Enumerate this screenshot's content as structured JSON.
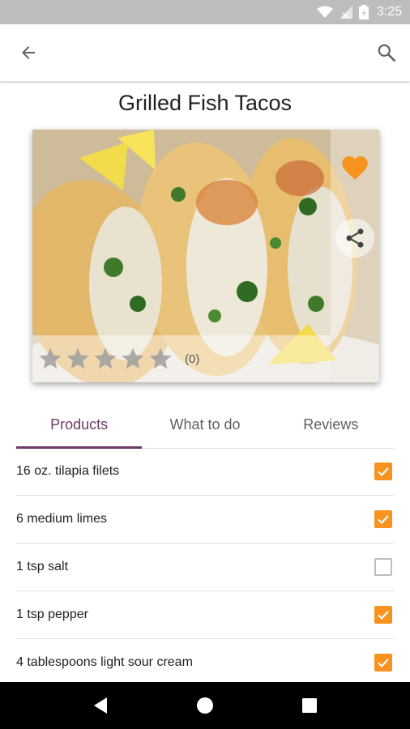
{
  "status_bar": {
    "time": "3:25"
  },
  "recipe": {
    "title": "Grilled Fish Tacos",
    "rating": {
      "stars": 0,
      "max_stars": 5,
      "count_label": "(0)"
    },
    "favorite": true
  },
  "tabs": [
    {
      "label": "Products",
      "active": true
    },
    {
      "label": "What to do",
      "active": false
    },
    {
      "label": "Reviews",
      "active": false
    }
  ],
  "products": [
    {
      "label": "16 oz. tilapia filets",
      "checked": true
    },
    {
      "label": "6 medium limes",
      "checked": true
    },
    {
      "label": "1 tsp salt",
      "checked": false
    },
    {
      "label": "1 tsp pepper",
      "checked": true
    },
    {
      "label": "4 tablespoons light sour cream",
      "checked": true
    }
  ],
  "icons": {
    "back": "arrow-left-icon",
    "search": "search-icon",
    "favorite": "heart-icon",
    "share": "share-icon",
    "nav_back": "triangle-back-icon",
    "nav_home": "circle-home-icon",
    "nav_recents": "square-recents-icon"
  },
  "colors": {
    "accent": "#f7931e",
    "tab_active": "#6d3a66",
    "status_bar": "#bdbdbd",
    "nav_bar": "#000000"
  }
}
